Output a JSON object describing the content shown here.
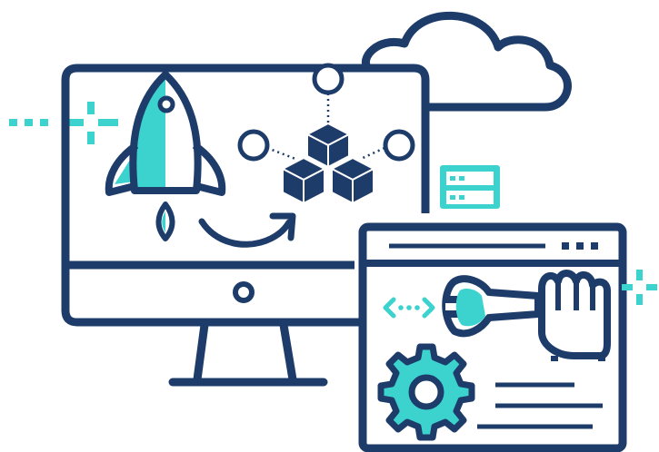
{
  "palette": {
    "navy": "#1d3c6a",
    "teal": "#3cd3cf",
    "white": "#ffffff"
  },
  "icons": [
    "cloud-icon",
    "desktop-monitor-icon",
    "rocket-icon",
    "arrow-icon",
    "cubes-network-icon",
    "server-icon",
    "browser-window-icon",
    "code-brackets-icon",
    "wrench-icon",
    "hand-icon",
    "gear-icon",
    "sparkle-icon"
  ]
}
